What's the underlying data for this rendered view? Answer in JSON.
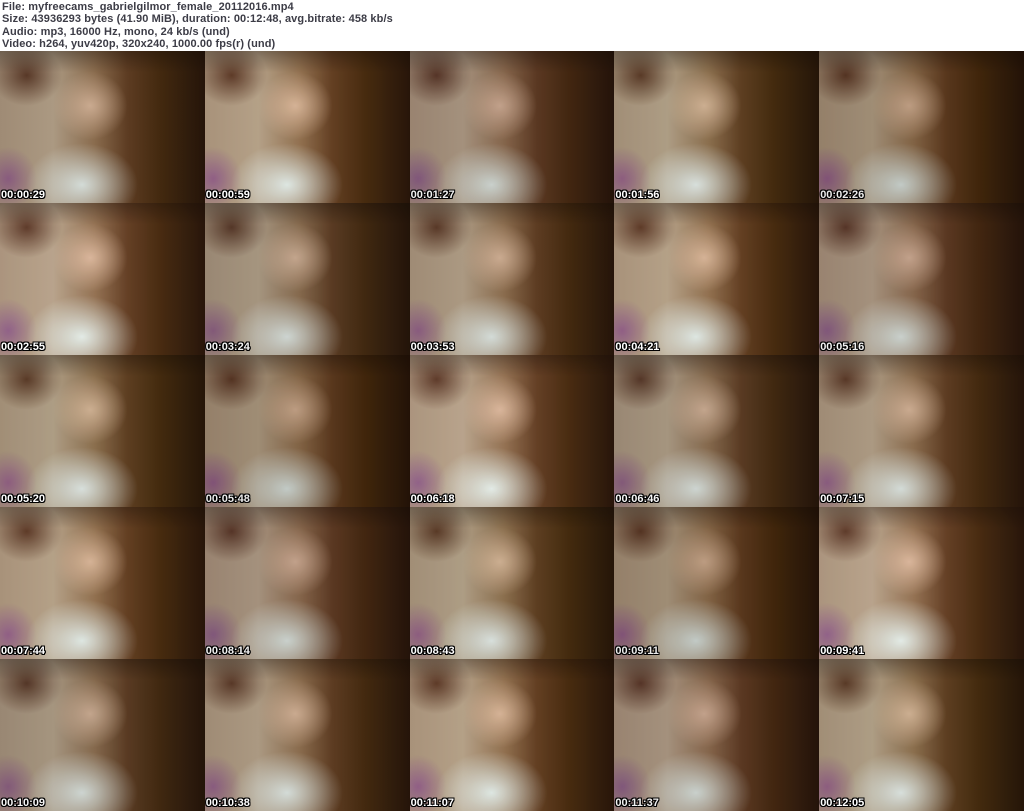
{
  "header": {
    "lines": [
      "File: myfreecams_gabrielgilmor_female_20112016.mp4",
      "Size: 43936293 bytes (41.90 MiB), duration: 00:12:48, avg.bitrate: 458 kb/s",
      "Audio: mp3, 16000 Hz, mono, 24 kb/s (und)",
      "Video: h264, yuv420p, 320x240, 1000.00 fps(r) (und)"
    ]
  },
  "grid": {
    "columns": 5,
    "rows": 5,
    "thumbnails": [
      {
        "timestamp": "00:00:29"
      },
      {
        "timestamp": "00:00:59"
      },
      {
        "timestamp": "00:01:27"
      },
      {
        "timestamp": "00:01:56"
      },
      {
        "timestamp": "00:02:26"
      },
      {
        "timestamp": "00:02:55"
      },
      {
        "timestamp": "00:03:24"
      },
      {
        "timestamp": "00:03:53"
      },
      {
        "timestamp": "00:04:21"
      },
      {
        "timestamp": "00:05:16"
      },
      {
        "timestamp": "00:05:20"
      },
      {
        "timestamp": "00:05:48"
      },
      {
        "timestamp": "00:06:18"
      },
      {
        "timestamp": "00:06:46"
      },
      {
        "timestamp": "00:07:15"
      },
      {
        "timestamp": "00:07:44"
      },
      {
        "timestamp": "00:08:14"
      },
      {
        "timestamp": "00:08:43"
      },
      {
        "timestamp": "00:09:11"
      },
      {
        "timestamp": "00:09:41"
      },
      {
        "timestamp": "00:10:09"
      },
      {
        "timestamp": "00:10:38"
      },
      {
        "timestamp": "00:11:07"
      },
      {
        "timestamp": "00:11:37"
      },
      {
        "timestamp": "00:12:05"
      }
    ]
  },
  "colors": {
    "header_bg": "#ffffff",
    "header_text": "#3c3c46",
    "timestamp_text": "#ffffff",
    "timestamp_outline": "#000000",
    "scene_wall": "#ab9982",
    "scene_wood_mid": "#5d3c22",
    "scene_wood_dark": "#2f1c0c",
    "scene_accent_purple": "#804a80",
    "scene_pale_garment": "#deecec"
  }
}
